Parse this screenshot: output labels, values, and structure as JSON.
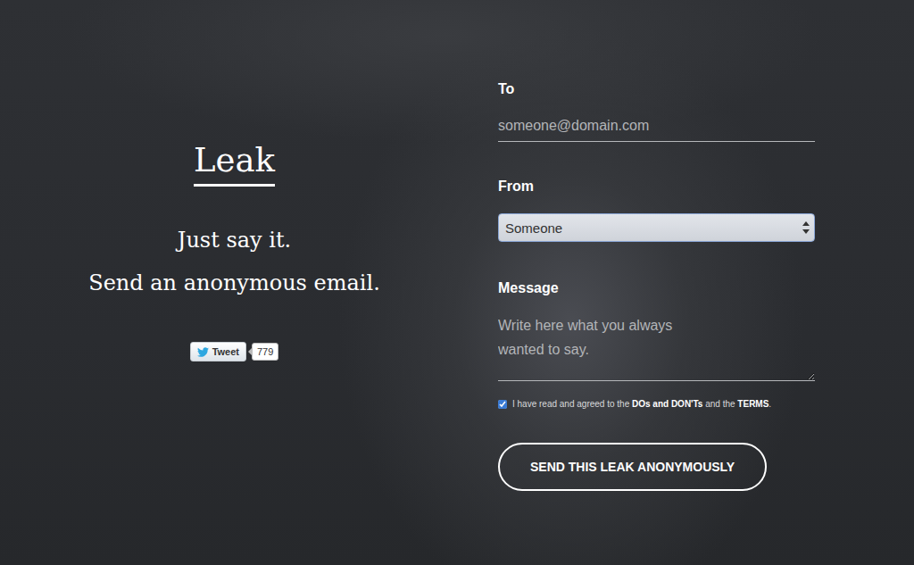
{
  "brand": {
    "title": "Leak"
  },
  "tagline": [
    "Just say it.",
    "Send an anonymous email."
  ],
  "tweet": {
    "label": "Tweet",
    "count": "779"
  },
  "form": {
    "to": {
      "label": "To",
      "placeholder": "someone@domain.com"
    },
    "from": {
      "label": "From",
      "value": "Someone"
    },
    "message": {
      "label": "Message",
      "placeholder": "Write here what you always wanted to say."
    },
    "agreement": {
      "checked": true,
      "parts": [
        {
          "text": "I have read and agreed to the ",
          "bold": false
        },
        {
          "text": "DOs and DON'Ts",
          "bold": true
        },
        {
          "text": " and the ",
          "bold": false
        },
        {
          "text": "TERMS",
          "bold": true
        },
        {
          "text": ".",
          "bold": false
        }
      ]
    },
    "submit": "SEND THIS LEAK ANONYMOUSLY"
  }
}
